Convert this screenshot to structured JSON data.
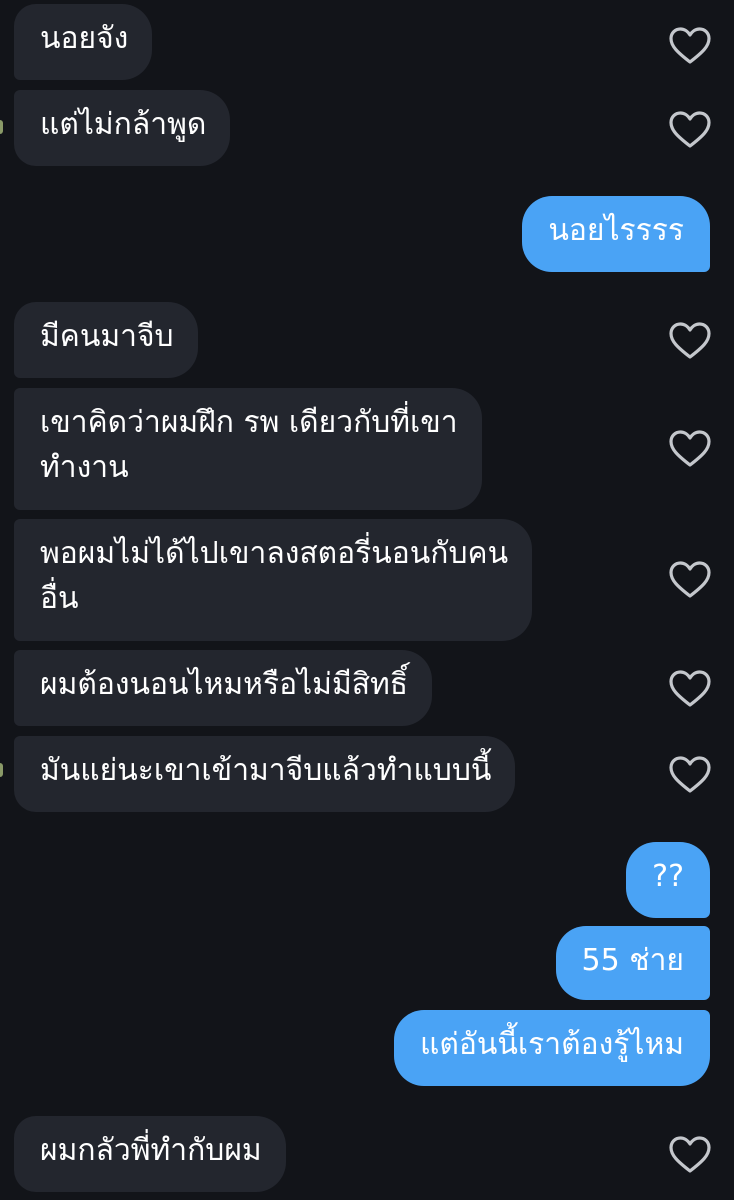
{
  "theme": {
    "background": "#121419",
    "incoming_bubble": "#23262e",
    "outgoing_bubble": "#4aa3f5",
    "text": "#ffffff",
    "heart_outline": "#c4c7cc"
  },
  "messages": [
    {
      "direction": "incoming",
      "text": "นอยจัง",
      "icon": "heart-outline-icon"
    },
    {
      "direction": "incoming",
      "text": "แต่ไม่กล้าพูด",
      "icon": "heart-outline-icon"
    },
    {
      "direction": "outgoing",
      "text": "นอยไรรรร"
    },
    {
      "direction": "incoming",
      "text": "มีคนมาจีบ",
      "icon": "heart-outline-icon"
    },
    {
      "direction": "incoming",
      "lines": [
        "เขาคิดว่าผมฝึก รพ เดียวกับที่เขา",
        "ทำงาน"
      ],
      "icon": "heart-outline-icon"
    },
    {
      "direction": "incoming",
      "lines": [
        "พอผมไม่ได้ไปเขาลงสตอรี่นอนกับคน",
        "อื่น"
      ],
      "icon": "heart-outline-icon"
    },
    {
      "direction": "incoming",
      "text": "ผมต้องนอนไหมหรือไม่มีสิทธิ์",
      "icon": "heart-outline-icon"
    },
    {
      "direction": "incoming",
      "text": "มันแย่นะเขาเข้ามาจีบแล้วทำแบบนี้",
      "icon": "heart-outline-icon"
    },
    {
      "direction": "outgoing",
      "text": "??"
    },
    {
      "direction": "outgoing",
      "text": "55 ช่าย"
    },
    {
      "direction": "outgoing",
      "text": "แต่อันนี้เราต้องรู้ไหม"
    },
    {
      "direction": "incoming",
      "text": "ผมกลัวพี่ทำกับผม",
      "icon": "heart-outline-icon"
    }
  ]
}
